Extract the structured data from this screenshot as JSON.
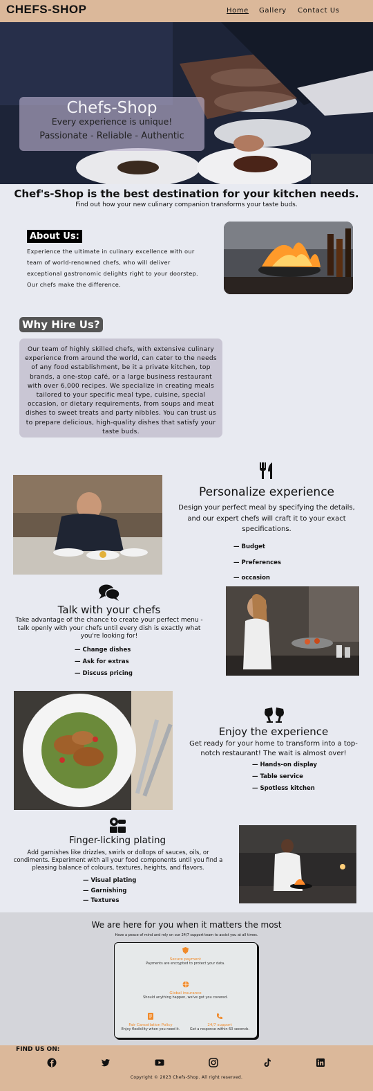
{
  "nav": {
    "brand": "CHEFS-SHOP",
    "links": [
      "Home",
      "Gallery",
      "Contact Us"
    ]
  },
  "hero": {
    "title": "Chefs-Shop",
    "subtitle": "Every experience is unique!",
    "tagline": "Passionate - Reliable - Authentic"
  },
  "intro": {
    "heading": "Chef's-Shop is the best destination for your kitchen needs.",
    "text": "Find out how your new culinary companion transforms your taste buds."
  },
  "about": {
    "heading": "About Us:",
    "text": "Experience the ultimate in culinary excellence with our team of world-renowned chefs, who will deliver exceptional gastronomic delights right to your doorstep. Our chefs make the difference."
  },
  "why": {
    "heading": "Why Hire Us?",
    "text": "Our team of highly skilled chefs, with extensive culinary experience from around the world, can cater to the needs of any food establishment, be it a private kitchen, top brands, a one-stop café, or a large business restaurant with over 6,000 recipes. We specialize in creating meals tailored to your specific meal type, cuisine, special occasion, or dietary requirements, from soups and meat dishes to sweet treats and party nibbles. You can trust us to prepare delicious, high-quality dishes that satisfy your taste buds."
  },
  "features": [
    {
      "icon": "utensils-icon",
      "title": "Personalize experience",
      "desc": "Design your perfect meal by specifying the details, and our expert chefs will craft it to your exact specifications.",
      "items": [
        "— Budget",
        "— Preferences",
        "— occasion"
      ]
    },
    {
      "icon": "comments-icon",
      "title": "Talk with your chefs",
      "desc": "Take advantage of the chance to create your perfect menu - talk openly with your chefs until every dish is exactly what you're looking for!",
      "items": [
        "— Change dishes",
        "— Ask for extras",
        "— Discuss pricing"
      ]
    },
    {
      "icon": "champagne-glasses-icon",
      "title": "Enjoy the experience",
      "desc": "Get ready for your home to transform into a top-notch restaurant! The wait is almost over!",
      "items": [
        "— Hands-on display",
        "— Table service",
        "— Spotless kitchen"
      ]
    },
    {
      "icon": "kitchen-set-icon",
      "title": "Finger-licking plating",
      "desc": "Add garnishes like drizzles, swirls or dollops of sauces, oils, or condiments. Experiment with all your food components until you find a pleasing balance of colours, textures, heights, and flavors.",
      "items": [
        "— Visual plating",
        "— Garnishing",
        "— Textures"
      ]
    }
  ],
  "support": {
    "heading": "We are here for you when it matters the most",
    "text": "Have a peace of mind and rely on our 24/7 support team to assist you at all times.",
    "items": [
      {
        "icon": "shield-icon",
        "title": "Secure payment",
        "desc": "Payments are encrypted to protect your data."
      },
      {
        "icon": "globe-icon",
        "title": "Global insurance",
        "desc": "Should anything happen, we've got you covered."
      },
      {
        "icon": "document-icon",
        "title": "Fair Cancellation Policy",
        "desc": "Enjoy flexibility when you need it."
      },
      {
        "icon": "phone-icon",
        "title": "24/7 support",
        "desc": "Get a response within 60 seconds."
      }
    ],
    "accent": "#f08a2a"
  },
  "footer": {
    "find_label": "FIND US ON:",
    "socials": [
      "facebook-icon",
      "twitter-icon",
      "youtube-icon",
      "instagram-icon",
      "tiktok-icon",
      "linkedin-icon"
    ],
    "copyright": "Copyright © 2023 Chefs-Shop. All right reserved."
  },
  "colors": {
    "nav_bg": "#dbb89a",
    "page_bg": "#e8eaf1",
    "support_bg": "#d4d5da"
  }
}
